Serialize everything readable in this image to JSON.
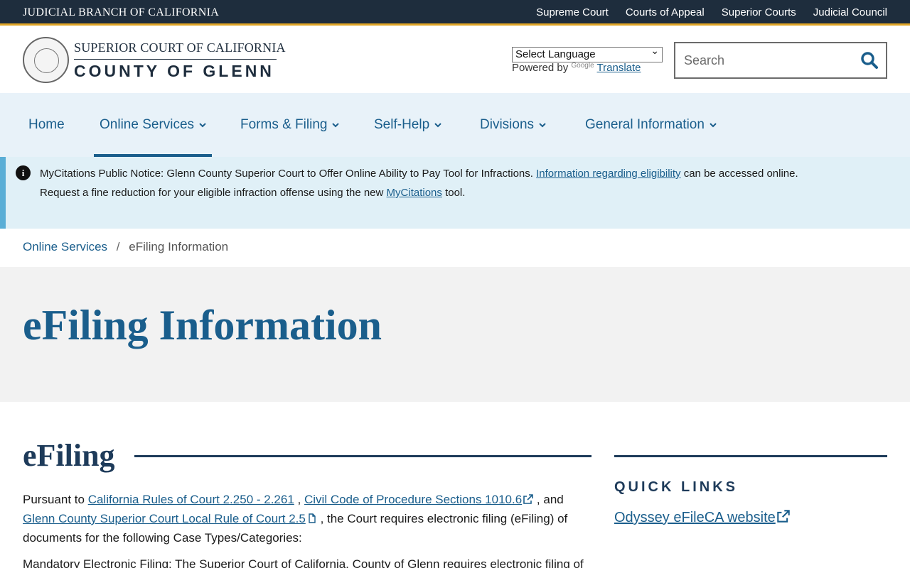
{
  "topbar": {
    "title": "JUDICIAL BRANCH OF CALIFORNIA",
    "links": [
      "Supreme Court",
      "Courts of Appeal",
      "Superior Courts",
      "Judicial Council"
    ]
  },
  "header": {
    "logo_line1": "SUPERIOR COURT OF CALIFORNIA",
    "logo_line2": "COUNTY OF GLENN",
    "language_select": "Select Language",
    "powered_by": "Powered by",
    "google": "Google",
    "translate": "Translate",
    "search_placeholder": "Search"
  },
  "nav": {
    "items": [
      "Home",
      "Online Services",
      "Forms & Filing",
      "Self-Help",
      "Divisions",
      "General Information"
    ],
    "active": "Online Services"
  },
  "notice": {
    "line1_text": "MyCitations Public Notice: Glenn County Superior Court to Offer Online Ability to Pay Tool for Infractions.",
    "line1_link": "Information regarding eligibility",
    "line1_tail": "can be accessed online.",
    "line2_text": "Request a fine reduction for your eligible infraction offense using the new",
    "line2_link": "MyCitations",
    "line2_tail": "tool."
  },
  "breadcrumb": {
    "parent": "Online Services",
    "separator": "/",
    "current": "eFiling Information"
  },
  "page_title": "eFiling Information",
  "content": {
    "section_title": "eFiling",
    "p1_start": "Pursuant to",
    "link1": "California Rules of Court 2.250 - 2.261",
    "comma1": ",",
    "link2": "Civil Code of Procedure Sections 1010.6",
    "and": ",  and",
    "link3": "Glenn County Superior Court Local Rule of Court 2.5",
    "p1_end": ", the Court requires electronic filing (eFiling) of documents for the following Case Types/Categories:",
    "p2": "Mandatory Electronic Filing: The Superior Court of California, County of Glenn requires electronic filing of"
  },
  "sidebar": {
    "title": "QUICK LINKS",
    "links": [
      "Odyssey eFileCA website"
    ]
  },
  "colors": {
    "topbar": "#1e2d3d",
    "accent_gold": "#e0a526",
    "link_blue": "#1a5e8c",
    "nav_bg": "#e8f2f9",
    "notice_bg": "#e0f0f7",
    "title_band": "#f2f2f2"
  }
}
